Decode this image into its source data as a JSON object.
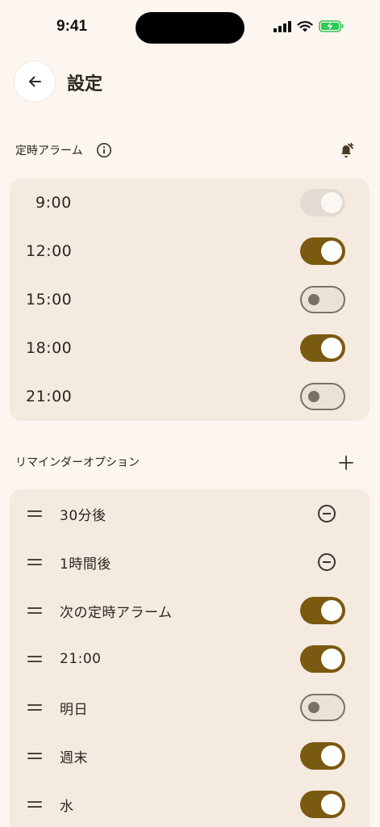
{
  "status_bar": {
    "time": "9:41"
  },
  "header": {
    "title": "設定"
  },
  "alarms": {
    "heading": "定時アラーム",
    "items": [
      {
        "time": "9:00",
        "state": "disabled"
      },
      {
        "time": "12:00",
        "state": "on"
      },
      {
        "time": "15:00",
        "state": "off"
      },
      {
        "time": "18:00",
        "state": "on"
      },
      {
        "time": "21:00",
        "state": "off"
      }
    ]
  },
  "reminders": {
    "heading": "リマインダーオプション",
    "items": [
      {
        "label": "30分後",
        "control": "remove"
      },
      {
        "label": "1時間後",
        "control": "remove"
      },
      {
        "label": "次の定時アラーム",
        "control": "on"
      },
      {
        "label": "21:00",
        "control": "on"
      },
      {
        "label": "明日",
        "control": "off"
      },
      {
        "label": "週末",
        "control": "on"
      },
      {
        "label": "水",
        "control": "on"
      }
    ]
  },
  "colors": {
    "background": "#fdf5ef",
    "card": "#f5eadf",
    "accent": "#7a5a10"
  },
  "icons": [
    "back-arrow-icon",
    "info-icon",
    "alarm-add-icon",
    "plus-icon",
    "drag-handle-icon",
    "remove-circle-icon",
    "signal-icon",
    "wifi-icon",
    "battery-charging-icon"
  ]
}
